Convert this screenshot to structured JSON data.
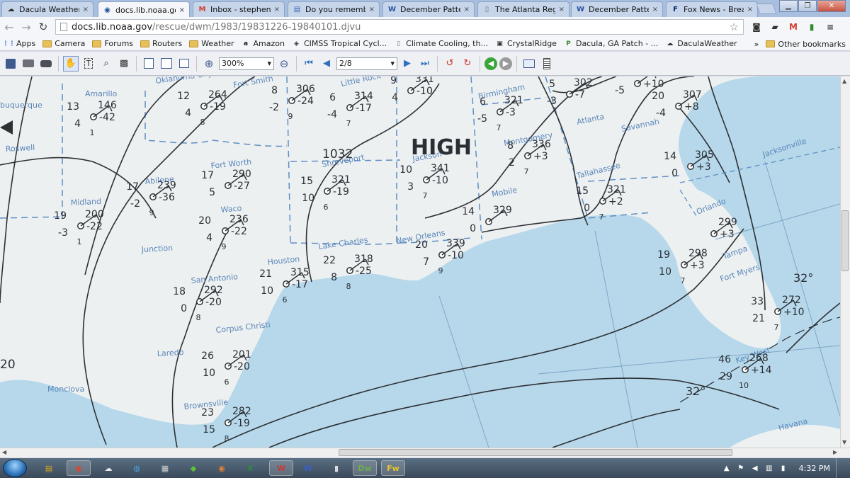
{
  "tabs": [
    {
      "label": "Dacula Weather - ",
      "icon": "weather-station-icon",
      "icon_glyph": "☁",
      "icon_color": "#333"
    },
    {
      "label": "docs.lib.noaa.gov",
      "icon": "noaa-icon",
      "icon_glyph": "◉",
      "icon_color": "#1f4e9a"
    },
    {
      "label": "Inbox - stephenrb",
      "icon": "gmail-icon",
      "icon_glyph": "M",
      "icon_color": "#d23f31"
    },
    {
      "label": "Do you remember",
      "icon": "forum-icon",
      "icon_glyph": "▤",
      "icon_color": "#3a63b1"
    },
    {
      "label": "December Pattern",
      "icon": "wx-forum-icon",
      "icon_glyph": "W",
      "icon_color": "#2b53a3"
    },
    {
      "label": "The Atlanta Regio",
      "icon": "page-icon",
      "icon_glyph": "▯",
      "icon_color": "#777"
    },
    {
      "label": "December Pattern",
      "icon": "wx-forum-icon",
      "icon_glyph": "W",
      "icon_color": "#2b53a3"
    },
    {
      "label": "Fox News - Breakin",
      "icon": "fox-news-icon",
      "icon_glyph": "F",
      "icon_color": "#0b2a66"
    }
  ],
  "tab_close_glyph": "×",
  "window_buttons": {
    "minimize": "▁",
    "restore": "❐",
    "close": "✕"
  },
  "nav": {
    "url_host": "docs.lib.noaa.gov",
    "url_path": "/rescue/dwm/1983/19831226-19840101.djvu",
    "back_glyph": "←",
    "forward_glyph": "→",
    "reload_glyph": "↻",
    "star_glyph": "☆",
    "extensions": [
      {
        "name": "binoculars-icon",
        "glyph": "◙",
        "color": "#333"
      },
      {
        "name": "tag-icon",
        "glyph": "▰",
        "color": "#333"
      },
      {
        "name": "gmail-icon",
        "glyph": "M",
        "color": "#d23f31"
      },
      {
        "name": "evernote-icon",
        "glyph": "▮",
        "color": "#2e8b2e"
      },
      {
        "name": "menu-icon",
        "glyph": "≡",
        "color": "#444"
      }
    ]
  },
  "bookmarks": {
    "items": [
      {
        "label": "Apps",
        "type": "apps",
        "icon": "apps-icon",
        "glyph": "⋮⋮",
        "color": "#4a7bd4"
      },
      {
        "label": "Camera",
        "type": "folder"
      },
      {
        "label": "Forums",
        "type": "folder"
      },
      {
        "label": "Routers",
        "type": "folder"
      },
      {
        "label": "Weather",
        "type": "folder"
      },
      {
        "label": "Amazon",
        "type": "site",
        "icon": "amazon-icon",
        "glyph": "a",
        "color": "#111"
      },
      {
        "label": "CIMSS Tropical Cycl...",
        "type": "site",
        "icon": "cimss-icon",
        "glyph": "◈",
        "color": "#333"
      },
      {
        "label": "Climate Cooling, th...",
        "type": "site",
        "icon": "page-icon",
        "glyph": "▯",
        "color": "#777"
      },
      {
        "label": "CrystalRidge",
        "type": "site",
        "icon": "crystalridge-icon",
        "glyph": "▣",
        "color": "#333"
      },
      {
        "label": "Dacula, GA Patch - ...",
        "type": "site",
        "icon": "patch-icon",
        "glyph": "P",
        "color": "#3b8a2e"
      },
      {
        "label": "DaculaWeather",
        "type": "site",
        "icon": "weather-station-icon",
        "glyph": "☁",
        "color": "#333"
      }
    ],
    "overflow_glyph": "»",
    "other_label": "Other bookmarks"
  },
  "djvu_toolbar": {
    "zoom_value": "300%",
    "page_value": "2/8",
    "zoom_in_glyph": "⊕",
    "zoom_out_glyph": "⊖",
    "dropdown_glyph": "▾"
  },
  "map": {
    "pressure_center_label": "HIGH",
    "pressure_center_value": "1032",
    "isotherm_labels": [
      "32°",
      "32°"
    ],
    "edge_label": "20",
    "places": [
      {
        "name": "Amarillo"
      },
      {
        "name": "buquerque"
      },
      {
        "name": "Oklahoma City"
      },
      {
        "name": "Fort Smith"
      },
      {
        "name": "Little Rock"
      },
      {
        "name": "Birmingham"
      },
      {
        "name": "Atlanta"
      },
      {
        "name": "Savannah"
      },
      {
        "name": "Montgomery"
      },
      {
        "name": "Jacksonville"
      },
      {
        "name": "Tallahassee"
      },
      {
        "name": "Mobile"
      },
      {
        "name": "Shreveport"
      },
      {
        "name": "Jackson"
      },
      {
        "name": "Fort Worth"
      },
      {
        "name": "Abilene"
      },
      {
        "name": "Waco"
      },
      {
        "name": "Midland"
      },
      {
        "name": "Roswell"
      },
      {
        "name": "Junction"
      },
      {
        "name": "Lake Charles"
      },
      {
        "name": "New Orleans"
      },
      {
        "name": "Houston"
      },
      {
        "name": "San Antonio"
      },
      {
        "name": "Corpus Christi"
      },
      {
        "name": "Laredo"
      },
      {
        "name": "Brownsville"
      },
      {
        "name": "Monclova"
      },
      {
        "name": "Orlando"
      },
      {
        "name": "Tampa"
      },
      {
        "name": "Fort Myers"
      },
      {
        "name": "Key West"
      },
      {
        "name": "Havana"
      }
    ],
    "stations": [
      {
        "temp": "13",
        "pressure": "146",
        "dew": "4",
        "tendency": "-42",
        "extra": "1"
      },
      {
        "temp": "12",
        "pressure": "264",
        "dew": "4",
        "tendency": "-19",
        "extra": "8"
      },
      {
        "temp": "8",
        "pressure": "306",
        "dew": "-2",
        "tendency": "-24",
        "extra": "9"
      },
      {
        "temp": "6",
        "pressure": "314",
        "dew": "-4",
        "tendency": "-17",
        "extra": "7"
      },
      {
        "temp": "9",
        "pressure": "331",
        "dew": "4",
        "tendency": "-10",
        "extra": ""
      },
      {
        "temp": "6",
        "pressure": "321",
        "dew": "-5",
        "tendency": "-3",
        "extra": "7"
      },
      {
        "temp": "5",
        "pressure": "302",
        "dew": "-3",
        "tendency": "-7",
        "extra": ""
      },
      {
        "temp": "",
        "pressure": "",
        "dew": "-5",
        "tendency": "+10",
        "extra": ""
      },
      {
        "temp": "20",
        "pressure": "307",
        "dew": "-4",
        "tendency": "+8",
        "extra": ""
      },
      {
        "temp": "14",
        "pressure": "305",
        "dew": "0",
        "tendency": "+3",
        "extra": ""
      },
      {
        "temp": "8",
        "pressure": "336",
        "dew": "2",
        "tendency": "+3",
        "extra": "7"
      },
      {
        "temp": "10",
        "pressure": "341",
        "dew": "3",
        "tendency": "-10",
        "extra": "7"
      },
      {
        "temp": "15",
        "pressure": "321",
        "dew": "10",
        "tendency": "-19",
        "extra": "6"
      },
      {
        "temp": "15",
        "pressure": "321",
        "dew": "0",
        "tendency": "+2",
        "extra": "7"
      },
      {
        "temp": "14",
        "pressure": "329",
        "dew": "0",
        "tendency": "",
        "extra": ""
      },
      {
        "temp": "17",
        "pressure": "290",
        "dew": "5",
        "tendency": "-27",
        "extra": ""
      },
      {
        "temp": "17",
        "pressure": "239",
        "dew": "-2",
        "tendency": "-36",
        "extra": "9"
      },
      {
        "temp": "20",
        "pressure": "236",
        "dew": "4",
        "tendency": "-22",
        "extra": "9"
      },
      {
        "temp": "19",
        "pressure": "200",
        "dew": "-3",
        "tendency": "-22",
        "extra": "1"
      },
      {
        "temp": "22",
        "pressure": "318",
        "dew": "8",
        "tendency": "-25",
        "extra": "8"
      },
      {
        "temp": "20",
        "pressure": "339",
        "dew": "7",
        "tendency": "-10",
        "extra": "9"
      },
      {
        "temp": "21",
        "pressure": "315",
        "dew": "10",
        "tendency": "-17",
        "extra": "6"
      },
      {
        "temp": "18",
        "pressure": "292",
        "dew": "0",
        "tendency": "-20",
        "extra": "8"
      },
      {
        "temp": "26",
        "pressure": "201",
        "dew": "10",
        "tendency": "-20",
        "extra": "6"
      },
      {
        "temp": "23",
        "pressure": "282",
        "dew": "15",
        "tendency": "-19",
        "extra": "8"
      },
      {
        "temp": "",
        "pressure": "299",
        "dew": "",
        "tendency": "+3",
        "extra": ""
      },
      {
        "temp": "19",
        "pressure": "298",
        "dew": "10",
        "tendency": "+3",
        "extra": "7"
      },
      {
        "temp": "33",
        "pressure": "272",
        "dew": "21",
        "tendency": "+10",
        "extra": "7"
      },
      {
        "temp": "46",
        "pressure": "268",
        "dew": "29",
        "tendency": "+14",
        "extra": "10"
      }
    ]
  },
  "taskbar": {
    "clock": "4:32 PM",
    "apps": [
      {
        "name": "explorer-icon",
        "glyph": "▤",
        "color": "#d9a521"
      },
      {
        "name": "chrome-icon",
        "glyph": "◉",
        "color": "#e0432f"
      },
      {
        "name": "weather-app-icon",
        "glyph": "☁",
        "color": "#e8e8e8"
      },
      {
        "name": "globe-icon",
        "glyph": "◍",
        "color": "#4aa3df"
      },
      {
        "name": "radar-icon",
        "glyph": "▦",
        "color": "#d0d0d0"
      },
      {
        "name": "green-app-icon",
        "glyph": "◆",
        "color": "#5bc236"
      },
      {
        "name": "firefox-icon",
        "glyph": "◉",
        "color": "#e8802f"
      },
      {
        "name": "excel-icon",
        "glyph": "X",
        "color": "#2e8b3a"
      },
      {
        "name": "wx-forum-icon",
        "glyph": "W",
        "color": "#c23b3b"
      },
      {
        "name": "wx-map-icon",
        "glyph": "W",
        "color": "#3b5fc2"
      },
      {
        "name": "notes-icon",
        "glyph": "▮",
        "color": "#dcdcdc"
      },
      {
        "name": "dreamweaver-icon",
        "glyph": "Dw",
        "color": "#6ab04c"
      },
      {
        "name": "fireworks-icon",
        "glyph": "Fw",
        "color": "#e6c42e"
      }
    ],
    "tray": [
      {
        "name": "show-hidden-icon",
        "glyph": "▲"
      },
      {
        "name": "flag-icon",
        "glyph": "⚑"
      },
      {
        "name": "volume-icon",
        "glyph": "◀"
      },
      {
        "name": "network-icon",
        "glyph": "▥"
      },
      {
        "name": "power-icon",
        "glyph": "▮"
      }
    ]
  },
  "colors": {
    "water": "#b6d8ea",
    "water_deep": "#a9d0e6",
    "land": "#eef1f2",
    "isobar": "#2d3136",
    "boundary": "#5e8ec4",
    "grid": "#7fa6c9"
  }
}
